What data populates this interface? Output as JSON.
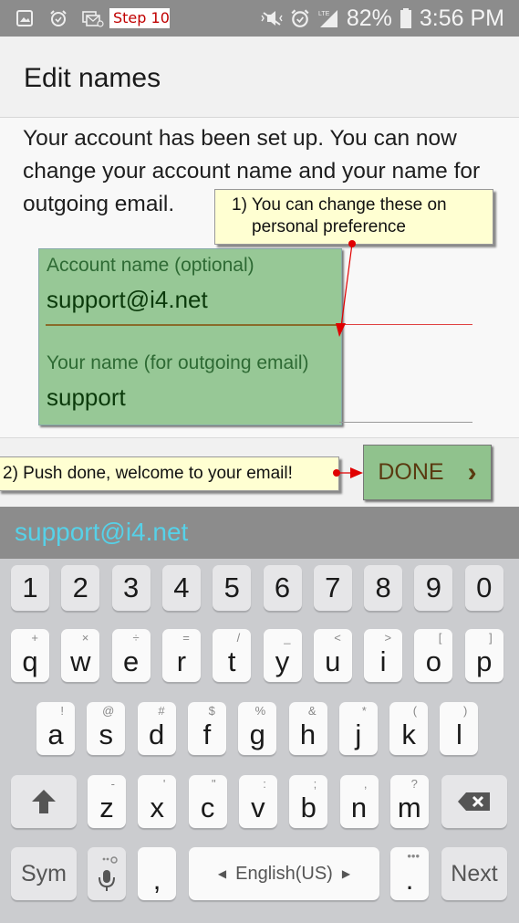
{
  "status_bar": {
    "left_icons": [
      "gallery-icon",
      "alarm-icon",
      "email-notification-icon"
    ],
    "step_label": "Step 10",
    "right_icons": [
      "vibrate-mute-icon",
      "alarm-icon",
      "lte-signal-icon"
    ],
    "network": "LTE",
    "battery": "82%",
    "time": "3:56 PM"
  },
  "header": {
    "title": "Edit names"
  },
  "description": "Your account has been set up. You can now change your account name and your name for outgoing email.",
  "fields": [
    {
      "label": "Account name (optional)",
      "value": "support@i4.net"
    },
    {
      "label": "Your name (for outgoing email)",
      "value": "support"
    }
  ],
  "callouts": [
    {
      "text_line1": "1) You can change these on",
      "text_line2": "personal preference"
    },
    {
      "text": "2) Push done, welcome to your email!"
    }
  ],
  "done_button": {
    "label": "DONE",
    "icon": "chevron-right-icon",
    "glyph": "›"
  },
  "suggestion_bar": {
    "text": "support@i4.net"
  },
  "keyboard": {
    "number_row": [
      "1",
      "2",
      "3",
      "4",
      "5",
      "6",
      "7",
      "8",
      "9",
      "0"
    ],
    "row1": [
      {
        "key": "q",
        "hint": "+"
      },
      {
        "key": "w",
        "hint": "×"
      },
      {
        "key": "e",
        "hint": "÷"
      },
      {
        "key": "r",
        "hint": "="
      },
      {
        "key": "t",
        "hint": "/"
      },
      {
        "key": "y",
        "hint": "_"
      },
      {
        "key": "u",
        "hint": "<"
      },
      {
        "key": "i",
        "hint": ">"
      },
      {
        "key": "o",
        "hint": "["
      },
      {
        "key": "p",
        "hint": "]"
      }
    ],
    "row2": [
      {
        "key": "a",
        "hint": "!"
      },
      {
        "key": "s",
        "hint": "@"
      },
      {
        "key": "d",
        "hint": "#"
      },
      {
        "key": "f",
        "hint": "$"
      },
      {
        "key": "g",
        "hint": "%"
      },
      {
        "key": "h",
        "hint": "&"
      },
      {
        "key": "j",
        "hint": "*"
      },
      {
        "key": "k",
        "hint": "("
      },
      {
        "key": "l",
        "hint": ")"
      }
    ],
    "row3": [
      {
        "key": "z",
        "hint": "-"
      },
      {
        "key": "x",
        "hint": "'"
      },
      {
        "key": "c",
        "hint": "\""
      },
      {
        "key": "v",
        "hint": ":"
      },
      {
        "key": "b",
        "hint": ";"
      },
      {
        "key": "n",
        "hint": ","
      },
      {
        "key": "m",
        "hint": "?"
      }
    ],
    "shift_icon": "shift-arrow-icon",
    "backspace_icon": "backspace-icon",
    "sym_label": "Sym",
    "mic_icon": "microphone-icon",
    "comma": ",",
    "space_label": "English(US)",
    "space_left_arrow": "◀",
    "space_right_arrow": "▶",
    "period": ".",
    "period_hint": "•••",
    "next_label": "Next"
  }
}
